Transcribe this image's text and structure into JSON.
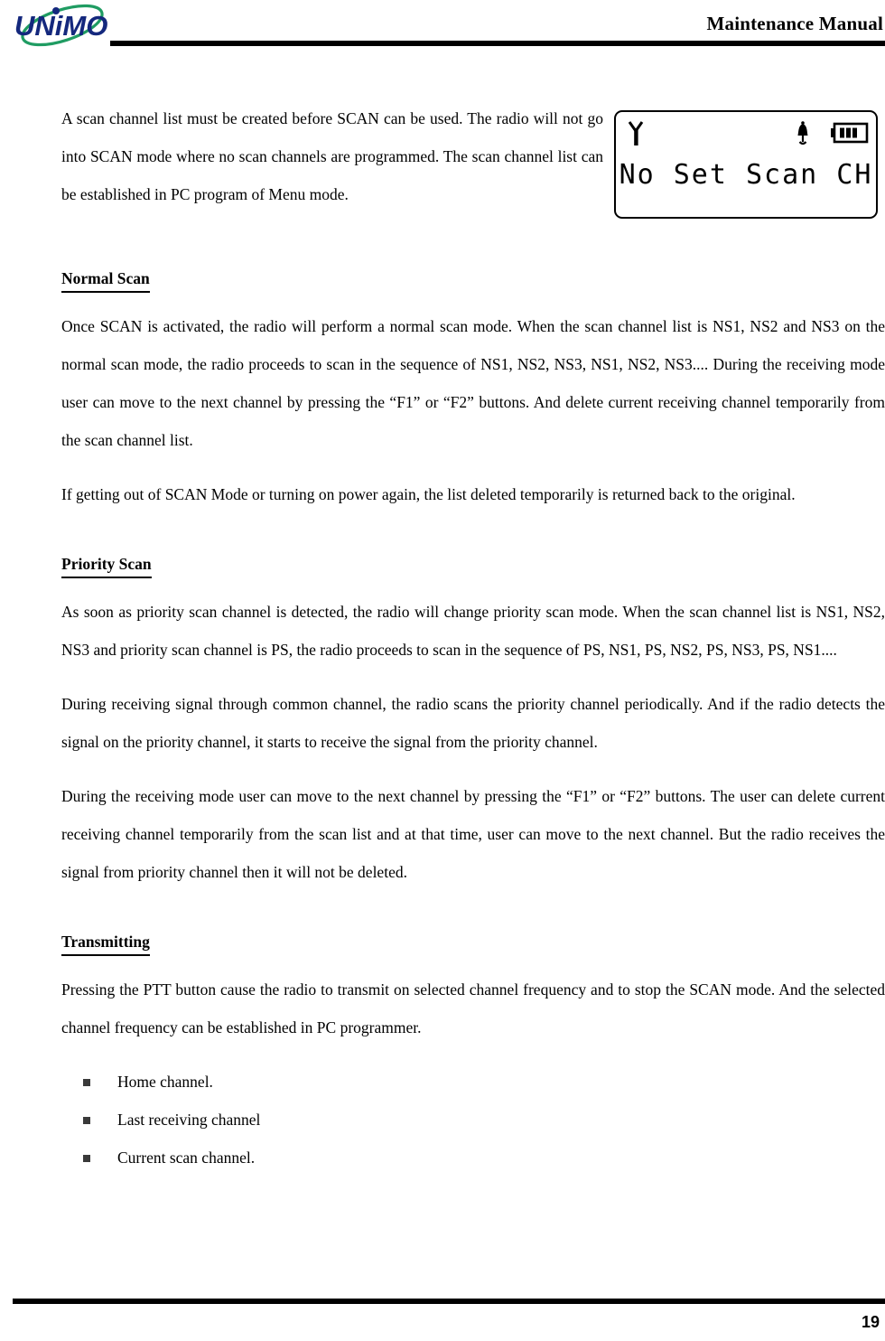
{
  "header": {
    "logo_text": "UNiMO",
    "logo_colors": {
      "text": "#14287d",
      "swoosh": "#1f9c62"
    },
    "title": "Maintenance Manual"
  },
  "lcd": {
    "display_text": "No Set Scan CH",
    "icons": [
      "antenna-icon",
      "bell-icon",
      "battery-icon"
    ],
    "battery_bars": 3
  },
  "content": {
    "intro_paragraph": "A scan channel list must be created before SCAN can be used. The radio will not go into SCAN mode where no scan channels are programmed. The scan channel list can be established in PC program of Menu mode.",
    "sections": [
      {
        "heading": "Normal Scan ",
        "paragraphs": [
          "Once SCAN is activated, the radio will perform a normal scan mode. When the scan channel list is NS1, NS2 and NS3 on the normal scan mode, the radio proceeds to scan in the sequence of NS1, NS2, NS3, NS1, NS2, NS3.... During the receiving mode user can move to the next channel by pressing the “F1” or “F2” buttons. And delete current receiving channel temporarily from the scan channel list.",
          "If getting out of SCAN Mode or turning on power again, the list deleted temporarily is returned back to the original."
        ]
      },
      {
        "heading": "Priority Scan ",
        "paragraphs": [
          "As soon as priority scan channel is detected, the radio will change priority scan mode. When the scan channel list is NS1, NS2, NS3 and priority scan channel is PS, the radio proceeds to scan in the sequence of PS, NS1, PS, NS2, PS, NS3, PS, NS1....",
          "During receiving signal through common channel, the radio scans the priority channel periodically. And if the radio detects the signal on the priority channel, it starts to receive the signal from the priority channel.",
          "During the receiving mode user can move to the next channel by pressing the “F1” or “F2” buttons. The user can delete current receiving channel temporarily from the scan list and at that time, user can move to the next channel. But the radio receives the signal from priority channel then it will not be deleted."
        ]
      },
      {
        "heading": "Transmitting",
        "paragraphs": [
          "Pressing the PTT button cause the radio to transmit on selected channel frequency and to stop the SCAN mode. And the selected channel frequency can be established in PC programmer."
        ],
        "bullets": [
          "Home channel.",
          "Last receiving channel",
          "Current scan channel."
        ]
      }
    ]
  },
  "footer": {
    "page_number": "19"
  }
}
